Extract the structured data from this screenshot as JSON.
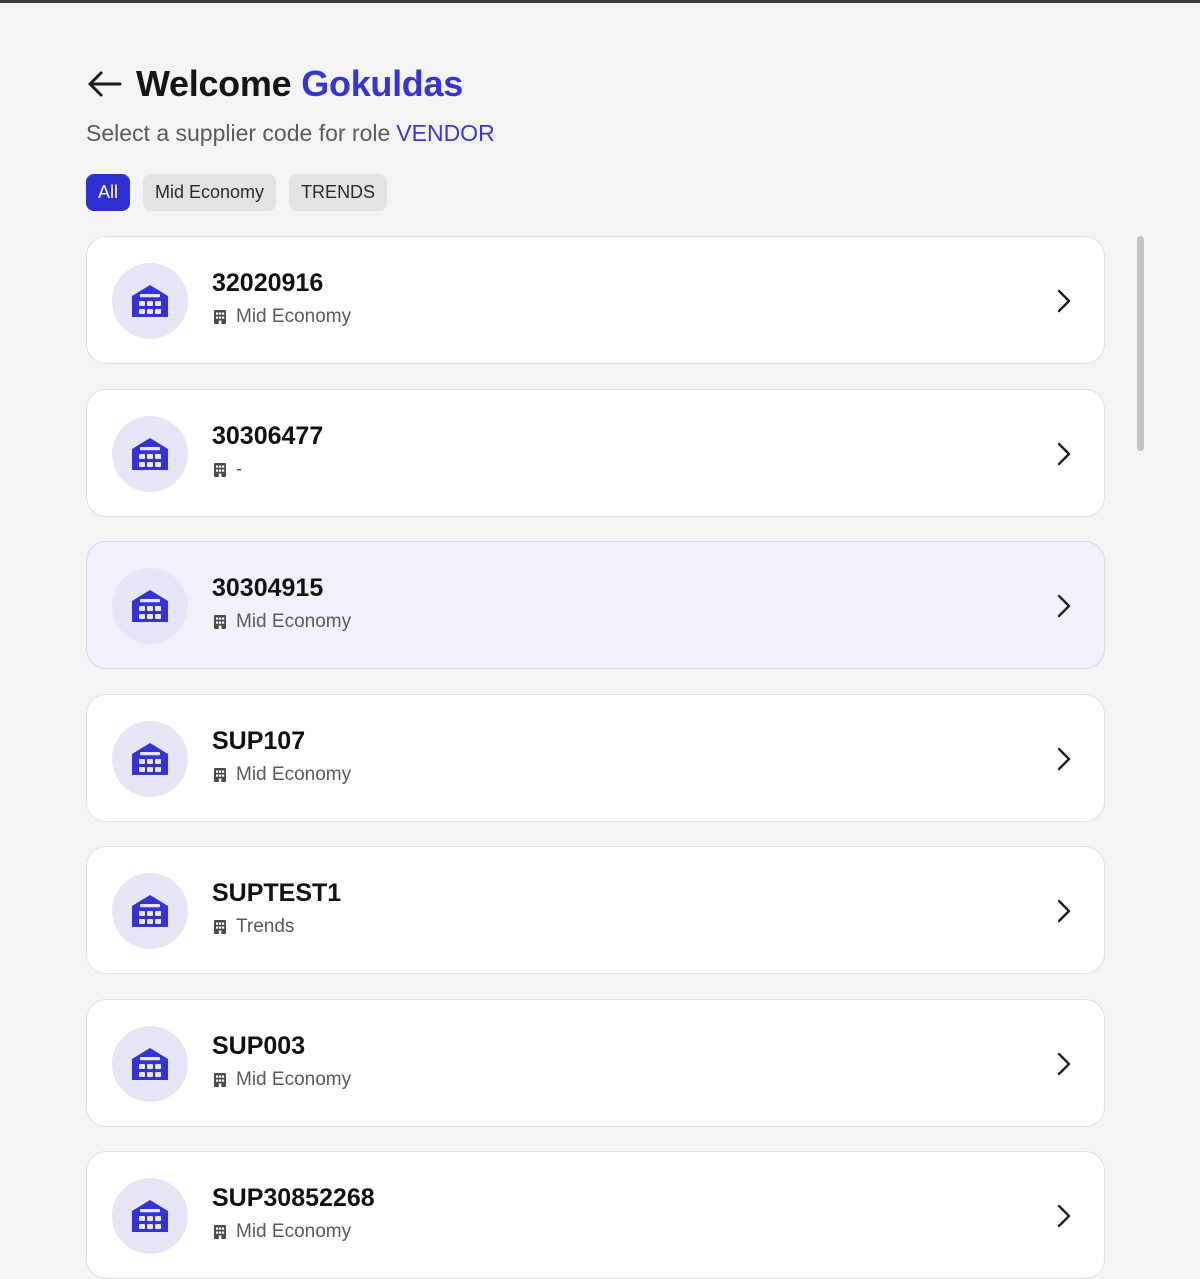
{
  "header": {
    "welcome_label": "Welcome",
    "user_name": "Gokuldas",
    "subtitle_prefix": "Select a supplier code for role",
    "role": "VENDOR"
  },
  "filters": [
    {
      "label": "All",
      "active": true
    },
    {
      "label": "Mid Economy",
      "active": false
    },
    {
      "label": "TRENDS",
      "active": false
    }
  ],
  "suppliers": [
    {
      "code": "32020916",
      "segment": "Mid Economy",
      "highlighted": false
    },
    {
      "code": "30306477",
      "segment": "-",
      "highlighted": false
    },
    {
      "code": "30304915",
      "segment": "Mid Economy",
      "highlighted": true
    },
    {
      "code": "SUP107",
      "segment": "Mid Economy",
      "highlighted": false
    },
    {
      "code": "SUPTEST1",
      "segment": "Trends",
      "highlighted": false
    },
    {
      "code": "SUP003",
      "segment": "Mid Economy",
      "highlighted": false
    },
    {
      "code": "SUP30852268",
      "segment": "Mid Economy",
      "highlighted": false
    }
  ],
  "icons": {
    "back": "arrow-left-icon",
    "supplier": "warehouse-icon",
    "segment": "building-icon",
    "open": "chevron-right-icon"
  },
  "colors": {
    "accent": "#3535d4",
    "chip_active": "#2f2fd8",
    "avatar_bg": "#e6e6f7",
    "card_highlight": "#f1f1fb",
    "page_bg": "#f4f4f4"
  }
}
